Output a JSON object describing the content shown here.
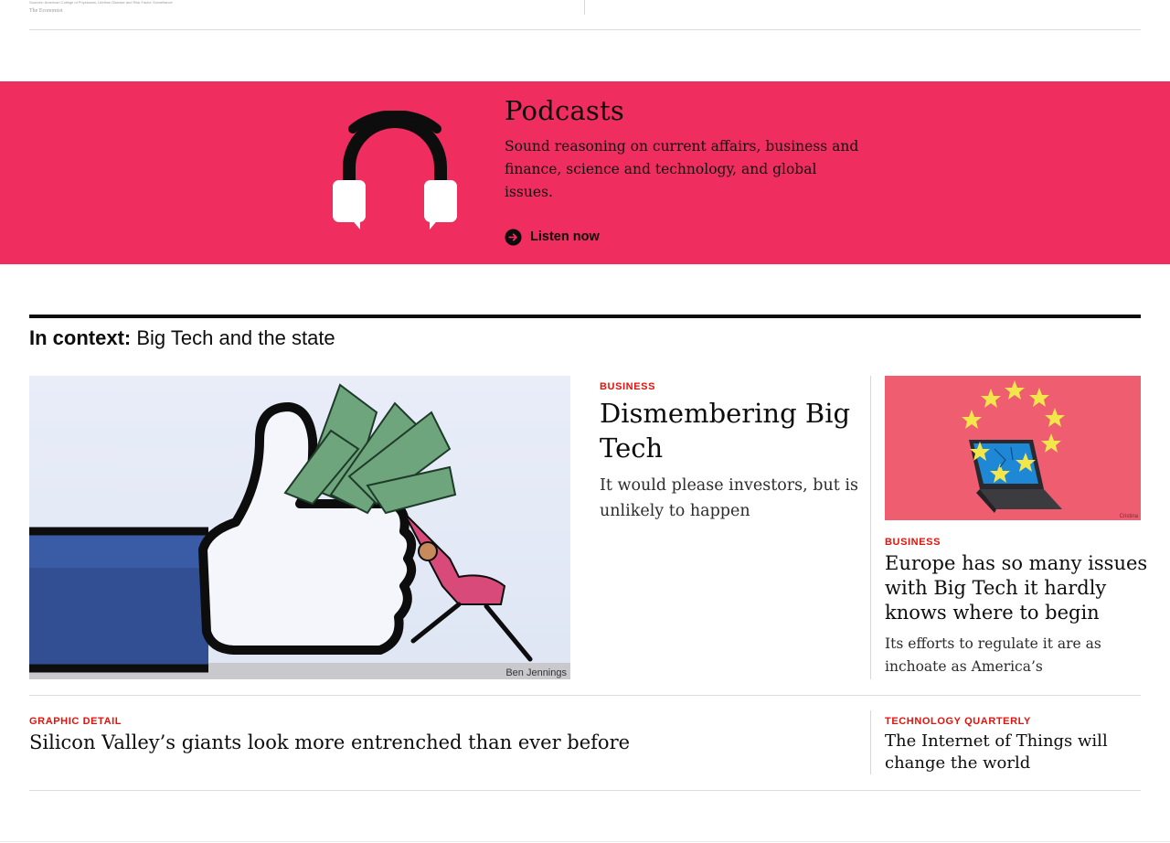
{
  "previous_section": {
    "source_note": "Sources: American College of Physicians; Lifetime Disease and Risk Factor Surveillance",
    "credit": "The Economist"
  },
  "podcasts": {
    "title": "Podcasts",
    "description": "Sound reasoning on current affairs, business and finance, science and technology, and global issues.",
    "cta_label": "Listen now",
    "background_color": "#ef2d5e",
    "icon": "headphones-icon"
  },
  "context": {
    "label_bold": "In context:",
    "label_topic": "Big Tech and the state"
  },
  "articles": {
    "lead": {
      "image_alt": "Illustration of a person pushing a giant thumbs-up hand stuffed with banknotes",
      "image_credit": "Ben Jennings",
      "section": "Business",
      "headline": "Dismembering Big Tech",
      "description": "It would please investors, but is unlikely to happen"
    },
    "side": {
      "image_alt": "Laptop with EU stars on a red background",
      "image_credit": "Cristina",
      "section": "Business",
      "headline": "Europe has so many issues with Big Tech it hardly knows where to begin",
      "description": "Its efforts to regulate it are as inchoate as America’s"
    },
    "bottom_left": {
      "section": "Graphic detail",
      "headline": "Silicon Valley’s giants look more entrenched than ever before"
    },
    "bottom_right": {
      "section": "Technology Quarterly",
      "headline": "The Internet of Things will change the world"
    }
  },
  "colors": {
    "accent_red": "#e3120b",
    "banner_pink": "#ef2d5e",
    "text": "#0d0d0d"
  }
}
